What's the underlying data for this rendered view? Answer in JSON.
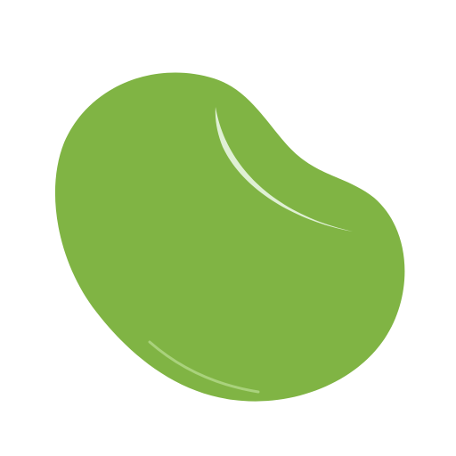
{
  "illustration": {
    "icon": "jelly-bean-icon",
    "colors": {
      "bean": "#80b444",
      "highlight": "#dff0d4",
      "rim_highlight": "#a9d27c",
      "background": "#ffffff"
    }
  }
}
